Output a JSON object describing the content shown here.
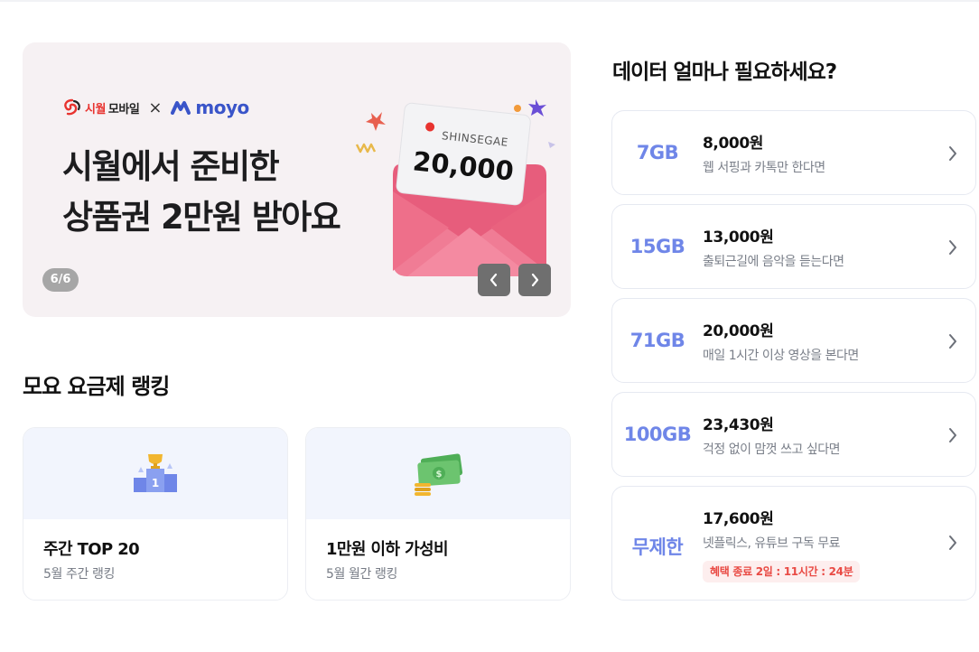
{
  "banner": {
    "brand_siwol_prefix": "시월",
    "brand_siwol_suffix": "모바일",
    "brand_x": "×",
    "brand_moyo": "moyo",
    "title_line1": "시월에서 준비한",
    "title_line2": "상품권 2만원 받아요",
    "card_brand": "SHINSEGAE",
    "card_amount": "20,000",
    "page_indicator": "6/6"
  },
  "ranking": {
    "title": "모요 요금제 랭킹",
    "cards": [
      {
        "title": "주간 TOP 20",
        "subtitle": "5월 주간 랭킹",
        "icon": "trophy-podium-icon"
      },
      {
        "title": "1만원 이하 가성비",
        "subtitle": "5월 월간 랭킹",
        "icon": "money-icon"
      }
    ]
  },
  "plans": {
    "heading": "데이터 얼마나 필요하세요?",
    "items": [
      {
        "gb": "7GB",
        "price": "8,000원",
        "desc": "웹 서핑과 카톡만 한다면"
      },
      {
        "gb": "15GB",
        "price": "13,000원",
        "desc": "출퇴근길에 음악을 듣는다면"
      },
      {
        "gb": "71GB",
        "price": "20,000원",
        "desc": "매일 1시간 이상 영상을 본다면"
      },
      {
        "gb": "100GB",
        "price": "23,430원",
        "desc": "걱정 없이 맘껏 쓰고 싶다면"
      },
      {
        "gb": "무제한",
        "price": "17,600원",
        "desc": "넷플릭스, 유튜브 구독 무료",
        "badge": "혜택 종료 2일 : 11시간 : 24분"
      }
    ]
  },
  "colors": {
    "accent": "#6f86e8",
    "brand_blue": "#3a55c9",
    "brand_red": "#e8332f",
    "banner_bg": "#f6f1f3",
    "badge_red": "#e94a44"
  }
}
